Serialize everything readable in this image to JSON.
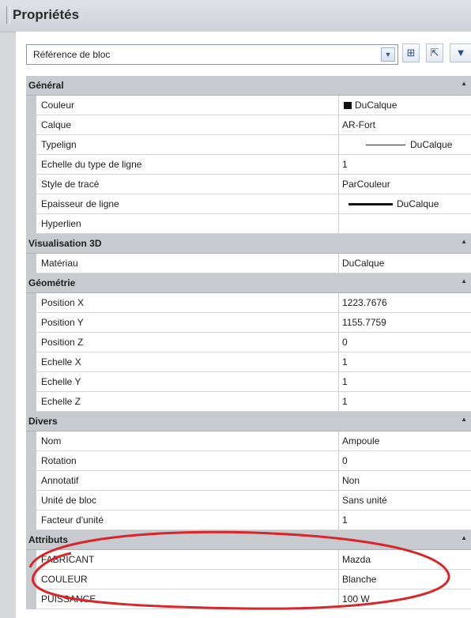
{
  "window": {
    "title": "Propriétés"
  },
  "selector": {
    "value": "Référence de bloc"
  },
  "toolbar": {
    "dropdown_icon": "chevron-down-icon",
    "icons": [
      "quick-select-icon",
      "select-objects-icon",
      "pickadd-filter-icon"
    ]
  },
  "sections": [
    {
      "title": "Général",
      "rows": [
        {
          "name": "Couleur",
          "value": "DuCalque",
          "decor": "swatch"
        },
        {
          "name": "Calque",
          "value": "AR-Fort"
        },
        {
          "name": "Typelign",
          "value": "DuCalque",
          "decor": "thin-line"
        },
        {
          "name": "Echelle du type de ligne",
          "value": "1"
        },
        {
          "name": "Style de tracé",
          "value": "ParCouleur"
        },
        {
          "name": "Epaisseur de ligne",
          "value": "DuCalque",
          "decor": "thick-line"
        },
        {
          "name": "Hyperlien",
          "value": ""
        }
      ]
    },
    {
      "title": "Visualisation 3D",
      "rows": [
        {
          "name": "Matériau",
          "value": "DuCalque"
        }
      ]
    },
    {
      "title": "Géométrie",
      "rows": [
        {
          "name": "Position X",
          "value": "1223.7676"
        },
        {
          "name": "Position Y",
          "value": "1155.7759"
        },
        {
          "name": "Position Z",
          "value": "0"
        },
        {
          "name": "Echelle X",
          "value": "1"
        },
        {
          "name": "Echelle Y",
          "value": "1"
        },
        {
          "name": "Echelle Z",
          "value": "1"
        }
      ]
    },
    {
      "title": "Divers",
      "rows": [
        {
          "name": "Nom",
          "value": "Ampoule"
        },
        {
          "name": "Rotation",
          "value": "0"
        },
        {
          "name": "Annotatif",
          "value": "Non"
        },
        {
          "name": "Unité de bloc",
          "value": "Sans unité"
        },
        {
          "name": "Facteur d'unité",
          "value": "1"
        }
      ]
    },
    {
      "title": "Attributs",
      "rows": [
        {
          "name": "FABRICANT",
          "value": "Mazda"
        },
        {
          "name": "COULEUR",
          "value": "Blanche"
        },
        {
          "name": "PUISSANCE",
          "value": "100 W"
        }
      ]
    }
  ],
  "annotation": {
    "color": "#d8262b",
    "shape": "ellipse"
  }
}
